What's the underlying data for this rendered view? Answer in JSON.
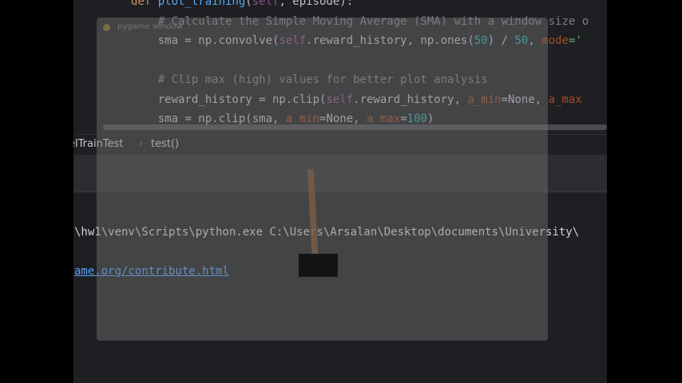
{
  "editor": {
    "lines": [
      {
        "segments": [
          {
            "t": "def ",
            "c": "kw"
          },
          {
            "t": "plot_training",
            "c": "fn"
          },
          {
            "t": "(",
            "c": ""
          },
          {
            "t": "self",
            "c": "self"
          },
          {
            "t": ", episode):",
            "c": ""
          }
        ]
      },
      {
        "segments": [
          {
            "t": "    # Calculate the Simple Moving Average (SMA) with a window size o",
            "c": "cm"
          }
        ]
      },
      {
        "segments": [
          {
            "t": "    sma = np.convolve(",
            "c": ""
          },
          {
            "t": "self",
            "c": "self"
          },
          {
            "t": ".reward_history, np.ones(",
            "c": ""
          },
          {
            "t": "50",
            "c": "num"
          },
          {
            "t": ") / ",
            "c": ""
          },
          {
            "t": "50",
            "c": "num"
          },
          {
            "t": ", ",
            "c": ""
          },
          {
            "t": "mode",
            "c": "param"
          },
          {
            "t": "='",
            "c": "str"
          }
        ]
      },
      {
        "segments": [
          {
            "t": "",
            "c": ""
          }
        ]
      },
      {
        "segments": [
          {
            "t": "    # Clip max (high) values for better plot analysis",
            "c": "cm"
          }
        ]
      },
      {
        "segments": [
          {
            "t": "    reward_history = np.clip(",
            "c": ""
          },
          {
            "t": "self",
            "c": "self"
          },
          {
            "t": ".reward_history, ",
            "c": ""
          },
          {
            "t": "a_min",
            "c": "param"
          },
          {
            "t": "=None, ",
            "c": ""
          },
          {
            "t": "a_max",
            "c": "param"
          }
        ]
      },
      {
        "segments": [
          {
            "t": "    sma = np.clip(sma, ",
            "c": ""
          },
          {
            "t": "a_min",
            "c": "param"
          },
          {
            "t": "=None, ",
            "c": ""
          },
          {
            "t": "a_max",
            "c": "param"
          },
          {
            "t": "=",
            "c": ""
          },
          {
            "t": "100",
            "c": "num"
          },
          {
            "t": ")",
            "c": ""
          }
        ]
      }
    ]
  },
  "breadcrumbs": {
    "class_name": "elTrainTest",
    "separator": "›",
    "method": "test()"
  },
  "console": {
    "command_line": "\\hw1\\venv\\Scripts\\python.exe C:\\Users\\Arsalan\\Desktop\\documents\\University\\",
    "link_text": "ame.org/contribute.html"
  },
  "pygame_window": {
    "title": "pygame window"
  },
  "colors": {
    "editor_bg": "#1e1f22",
    "keyword": "#cf8e6d",
    "function": "#56a8f5",
    "self": "#94558d",
    "comment": "#7a7e85",
    "number": "#2aacb8",
    "param": "#aa4926",
    "link": "#589df6"
  }
}
